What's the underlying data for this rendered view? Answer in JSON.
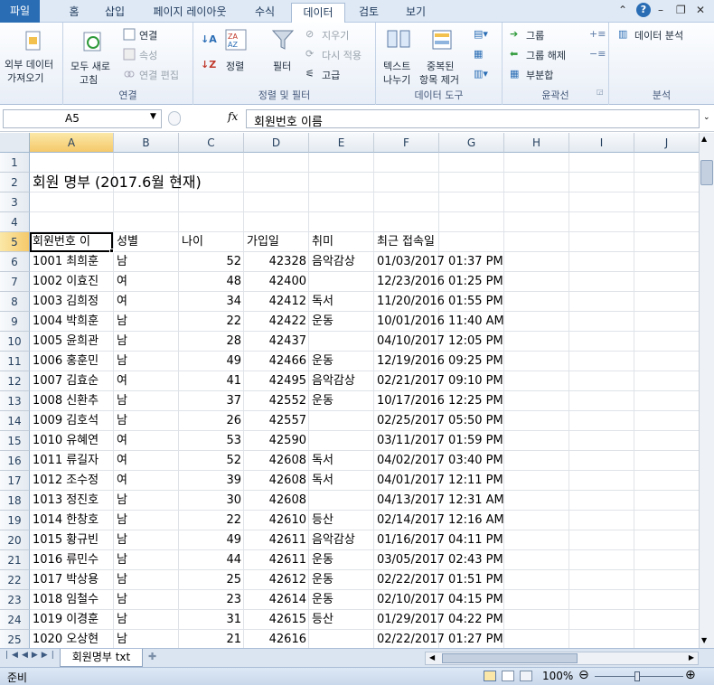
{
  "tabs": {
    "file": "파일",
    "home": "홈",
    "insert": "삽입",
    "layout": "페이지 레이아웃",
    "formulas": "수식",
    "data": "데이터",
    "review": "검토",
    "view": "보기"
  },
  "ribbon": {
    "external_data": "외부 데이터",
    "external_data2": "가져오기",
    "refresh": "모두 새로",
    "refresh2": "고침",
    "connections": "연결",
    "properties": "속성",
    "edit_links": "연결 편집",
    "group_connections": "연결",
    "sort": "정렬",
    "filter": "필터",
    "clear": "지우기",
    "reapply": "다시 적용",
    "advanced": "고급",
    "group_sort": "정렬 및 필터",
    "text_to_columns": "텍스트",
    "text_to_columns2": "나누기",
    "remove_dup": "중복된",
    "remove_dup2": "항목 제거",
    "group_tools": "데이터 도구",
    "group_btn": "그룹",
    "ungroup": "그룹 해제",
    "subtotal": "부분합",
    "group_outline": "윤곽선",
    "data_analysis": "데이터 분석",
    "group_analysis": "분석"
  },
  "namebox": "A5",
  "fx": "fx",
  "formula": "회원번호  이름",
  "columns": [
    "A",
    "B",
    "C",
    "D",
    "E",
    "F",
    "G",
    "H",
    "I",
    "J"
  ],
  "row_numbers": [
    "1",
    "2",
    "3",
    "4",
    "5",
    "6",
    "7",
    "8",
    "9",
    "10",
    "11",
    "12",
    "13",
    "14",
    "15",
    "16",
    "17",
    "18",
    "19",
    "20",
    "21",
    "22",
    "23",
    "24",
    "25"
  ],
  "title_cell": "회원 명부 (2017.6월 현재)",
  "headers": [
    "회원번호  이",
    "성별",
    "나이",
    "가입일",
    "취미",
    "최근 접속일"
  ],
  "members": [
    [
      "1001  최희훈",
      "남",
      "52",
      "42328",
      "음악감상",
      "01/03/2017 01:37 PM"
    ],
    [
      "1002  이효진",
      "여",
      "48",
      "42400",
      "",
      "12/23/2016 01:25 PM"
    ],
    [
      "1003  김희정",
      "여",
      "34",
      "42412",
      "독서",
      "11/20/2016 01:55 PM"
    ],
    [
      "1004  박희훈",
      "남",
      "22",
      "42422",
      "운동",
      "10/01/2016 11:40 AM"
    ],
    [
      "1005  윤희관",
      "남",
      "28",
      "42437",
      "",
      "04/10/2017 12:05 PM"
    ],
    [
      "1006  홍훈민",
      "남",
      "49",
      "42466",
      "운동",
      "12/19/2016 09:25 PM"
    ],
    [
      "1007  김효순",
      "여",
      "41",
      "42495",
      "음악감상",
      "02/21/2017 09:10 PM"
    ],
    [
      "1008  신환추",
      "남",
      "37",
      "42552",
      "운동",
      "10/17/2016 12:25 PM"
    ],
    [
      "1009  김호석",
      "남",
      "26",
      "42557",
      "",
      "02/25/2017 05:50 PM"
    ],
    [
      "1010  유혜연",
      "여",
      "53",
      "42590",
      "",
      "03/11/2017 01:59 PM"
    ],
    [
      "1011  류길자",
      "여",
      "52",
      "42608",
      "독서",
      "04/02/2017 03:40 PM"
    ],
    [
      "1012  조수정",
      "여",
      "39",
      "42608",
      "독서",
      "04/01/2017 12:11 PM"
    ],
    [
      "1013  정진호",
      "남",
      "30",
      "42608",
      "",
      "04/13/2017 12:31 AM"
    ],
    [
      "1014  한창호",
      "남",
      "22",
      "42610",
      "등산",
      "02/14/2017 12:16 AM"
    ],
    [
      "1015  황규빈",
      "남",
      "49",
      "42611",
      "음악감상",
      "01/16/2017 04:11 PM"
    ],
    [
      "1016  류민수",
      "남",
      "44",
      "42611",
      "운동",
      "03/05/2017 02:43 PM"
    ],
    [
      "1017  박상용",
      "남",
      "25",
      "42612",
      "운동",
      "02/22/2017 01:51 PM"
    ],
    [
      "1018  임철수",
      "남",
      "23",
      "42614",
      "운동",
      "02/10/2017 04:15 PM"
    ],
    [
      "1019  이경훈",
      "남",
      "31",
      "42615",
      "등산",
      "01/29/2017 04:22 PM"
    ],
    [
      "1020  오상현",
      "남",
      "21",
      "42616",
      "",
      "02/22/2017 01:27 PM"
    ]
  ],
  "sheet_tab": "회원명부 txt",
  "status": "준비",
  "zoom": "100%",
  "colors": {
    "accent": "#2a6db5",
    "selected_header": "#f5c96a"
  }
}
